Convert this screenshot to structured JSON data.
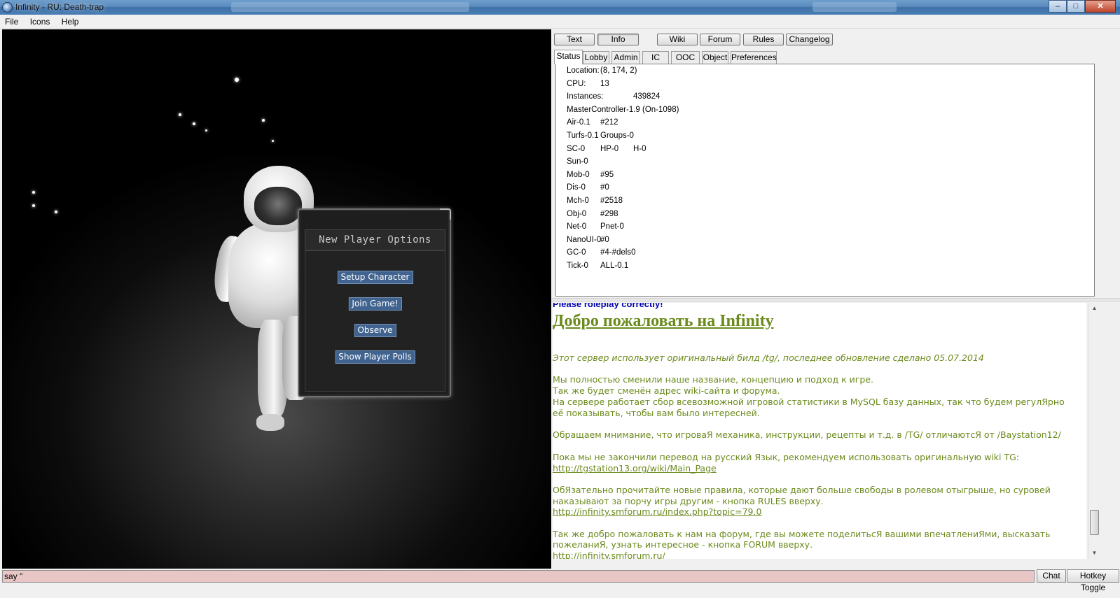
{
  "window": {
    "title": "Infinity - RU: Death-trap",
    "controls": [
      "–",
      "□",
      "✕"
    ]
  },
  "menu": [
    "File",
    "Icons",
    "Help"
  ],
  "new_player_options": {
    "title": "New Player Options",
    "buttons": [
      "Setup Character",
      "Join Game!",
      "Observe",
      "Show Player Polls"
    ]
  },
  "top_buttons": [
    "Text",
    "Info",
    "Wiki",
    "Forum",
    "Rules",
    "Changelog"
  ],
  "tabs": [
    "Status",
    "Lobby",
    "Admin",
    "IC",
    "OOC",
    "Object",
    "Preferences"
  ],
  "status": [
    [
      "Location:",
      "(8, 174, 2)",
      ""
    ],
    [
      "CPU:",
      "13",
      ""
    ],
    [
      "Instances:",
      "439824",
      ""
    ],
    [
      "MasterController-1.9 (On-1098)",
      "",
      ""
    ],
    [
      "Air-0.1",
      "#212",
      ""
    ],
    [
      "Turfs-0.1",
      "Groups-0",
      ""
    ],
    [
      "SC-0",
      "HP-0",
      "H-0"
    ],
    [
      "Sun-0",
      "",
      ""
    ],
    [
      "Mob-0",
      "#95",
      ""
    ],
    [
      "Dis-0",
      "#0",
      ""
    ],
    [
      "Mch-0",
      "#2518",
      ""
    ],
    [
      "Obj-0",
      "#298",
      ""
    ],
    [
      "Net-0",
      "Pnet-0",
      ""
    ],
    [
      "NanoUI-0",
      "#0",
      ""
    ],
    [
      "GC-0",
      "#4-#dels0",
      ""
    ],
    [
      "Tick-0",
      "ALL-0.1",
      ""
    ]
  ],
  "chat": {
    "cut_line": "Please roleplay correctly!",
    "heading": "Добро пожаловать на Infinity",
    "lines": [
      "Этот сервер использует оригинальный билд /tg/, последнее обновление сделано 05.07.2014",
      "Мы полностью сменили наше название, концепцию и подход к игре.",
      "Так же будет сменён адрес wiki-сайта и форума.",
      "На сервере работает сбор всевозможной игровой статистики в MySQL базу данных, так что будем регулЯрно",
      "её показывать, чтобы вам было интересней.",
      "Обращаем мнимание, что игроваЯ механика, инструкции, рецепты и т.д. в /TG/ отличаютсЯ от /Baystation12/",
      "Пока мы не закончили перевод на русский Язык, рекомендуем использовать оригинальную wiki TG:",
      "http://tgstation13.org/wiki/Main_Page",
      "ОбЯзательно прочитайте новые правила, которые дают больше свободы в ролевом отыгрыше, но суровей",
      "наказывают за порчу игры другим - кнопка RULES вверху.",
      "http://infinity.smforum.ru/index.php?topic=79.0",
      "Так же добро пожаловать к нам на форум, где вы можете поделитьсЯ вашими впечатлениЯми, высказать",
      "пожеланиЯ, узнать интересное - кнопка FORUM вверху.",
      "http://infinity.smforum.ru/"
    ]
  },
  "command": {
    "value": "say \"",
    "chat_label": "Chat",
    "hotkey_label": "Hotkey Toggle"
  },
  "colors": {
    "chat_text": "#6b8a1c",
    "command_bg": "#e8c6c6",
    "panel_button": "#40638f"
  }
}
